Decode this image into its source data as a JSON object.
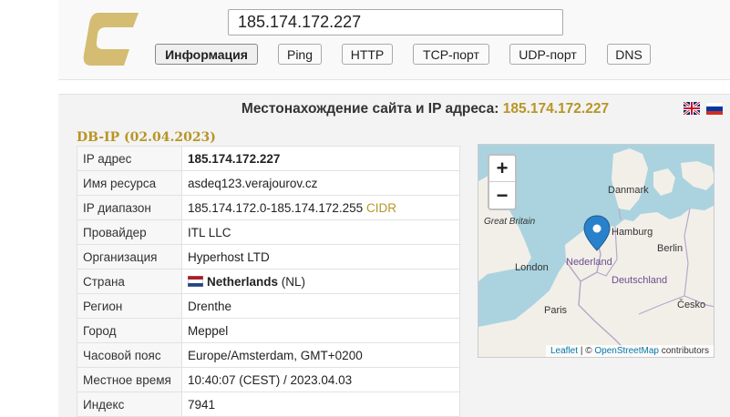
{
  "header": {
    "logo_icon": "letter-c-logo",
    "search_value": "185.174.172.227",
    "tabs": [
      {
        "label": "Информация",
        "active": true
      },
      {
        "label": "Ping"
      },
      {
        "label": "HTTP"
      },
      {
        "label": "TCP-порт"
      },
      {
        "label": "UDP-порт"
      },
      {
        "label": "DNS"
      }
    ]
  },
  "main": {
    "title_prefix": "Местонахождение сайта и IP адреса:",
    "title_ip": "185.174.172.227",
    "lang_flags": [
      "flag-uk-icon",
      "flag-ru-icon"
    ],
    "db_label": "DB-IP (02.04.2023)",
    "rows": [
      {
        "key": "IP адрес",
        "value": "185.174.172.227"
      },
      {
        "key": "Имя ресурса",
        "value": "asdeq123.verajourov.cz"
      },
      {
        "key": "IP диапазон",
        "value": "185.174.172.0-185.174.172.255",
        "extra": "CIDR"
      },
      {
        "key": "Провайдер",
        "value": "ITL LLC"
      },
      {
        "key": "Организация",
        "value": "Hyperhost LTD"
      },
      {
        "key": "Страна",
        "value": "Netherlands",
        "extra": "(NL)"
      },
      {
        "key": "Регион",
        "value": "Drenthe"
      },
      {
        "key": "Город",
        "value": "Meppel"
      },
      {
        "key": "Часовой пояс",
        "value": "Europe/Amsterdam, GMT+0200"
      },
      {
        "key": "Местное время",
        "value": "10:40:07 (CEST) / 2023.04.03"
      },
      {
        "key": "Индекс",
        "value": "7941"
      }
    ]
  },
  "map": {
    "zoom_in": "+",
    "zoom_out": "−",
    "labels": {
      "danmark": "Danmark",
      "great_britain": "Great Britain",
      "hamburg": "Hamburg",
      "berlin": "Berlin",
      "london": "London",
      "nederland": "Nederland",
      "deutschland": "Deutschland",
      "paris": "Paris",
      "cesko": "Česko"
    },
    "attribution": {
      "leaflet": "Leaflet",
      "separator": "|",
      "copyright": "©",
      "osm": "OpenStreetMap",
      "suffix": "contributors"
    },
    "colors": {
      "water": "#aad3df",
      "land": "#f2efe9",
      "marker": "#2a81cb"
    }
  },
  "colors": {
    "accent": "#b89525"
  }
}
